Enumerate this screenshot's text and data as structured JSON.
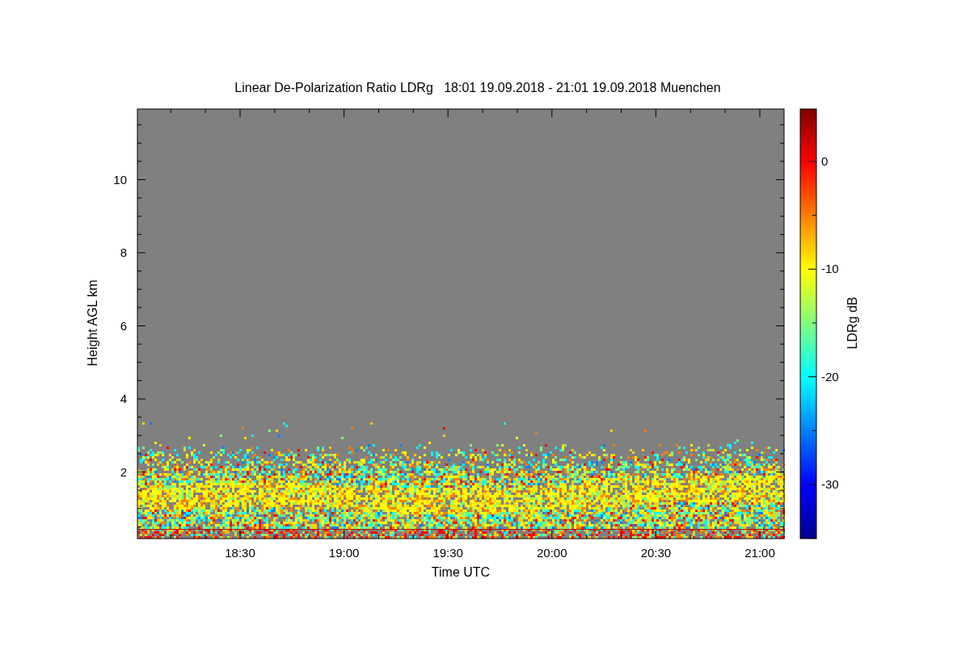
{
  "title": "Linear De-Polarization Ratio LDRg   18:01 19.09.2018 - 21:01 19.09.2018 Muenchen",
  "y_axis": {
    "label": "Height AGL km",
    "ticks": [
      "10",
      "8",
      "6",
      "4",
      "2"
    ]
  },
  "x_axis": {
    "label": "Time UTC",
    "ticks": [
      "18:30",
      "19:00",
      "19:30",
      "20:00",
      "20:30",
      "21:00"
    ]
  },
  "colorbar": {
    "label": "LDRg dB",
    "ticks": [
      "0",
      "-10",
      "-20",
      "-30"
    ]
  }
}
